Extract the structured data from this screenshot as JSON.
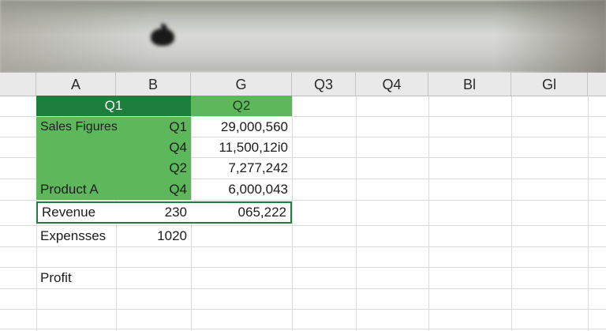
{
  "spreadsheet": {
    "column_headers": [
      "A",
      "B",
      "G",
      "Q3",
      "Q4",
      "Bl",
      "Gl"
    ],
    "header_cells": {
      "q1": "Q1",
      "q2": "Q2"
    },
    "rows": [
      {
        "label": "Sales Figures",
        "quarter": "Q1",
        "value": "29,000,560"
      },
      {
        "label": "",
        "quarter": "Q4",
        "value": "11,500,12i0"
      },
      {
        "label": "",
        "quarter": "Q2",
        "value": "7,277,242"
      },
      {
        "label": "Product A",
        "quarter": "Q4",
        "value": "6,000,043"
      }
    ],
    "revenue": {
      "label": "Revenue",
      "b": "230",
      "g": "065,222"
    },
    "expenses": {
      "label": "Expensses",
      "b": "1020"
    },
    "profit": {
      "label": "Profit"
    }
  },
  "colors": {
    "header_dark_green": "#1e7f3d",
    "cell_green": "#5cb85a"
  },
  "bezel": {
    "logo_icon": "apple-logo-icon"
  }
}
